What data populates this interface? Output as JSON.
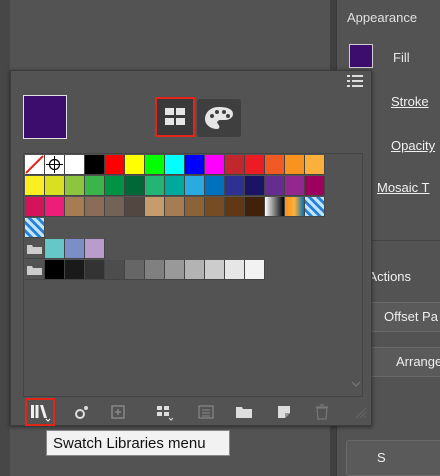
{
  "appearance": {
    "title": "Appearance",
    "fill_label": "Fill",
    "stroke_label": "Stroke",
    "opacity_label": "Opacity",
    "effect_label": "Mosaic T",
    "fill_color": "#3d0d6d"
  },
  "quick_actions": {
    "title": "k Actions",
    "offset_label": "Offset Pa",
    "arrange_label": "Arrange",
    "bottom_label": "S"
  },
  "swatches_panel": {
    "fill_color": "#3d0d6d",
    "rows": [
      [
        "none",
        "registration",
        "#ffffff",
        "#000000",
        "#ff0000",
        "#ffff00",
        "#00ff00",
        "#00ffff",
        "#0000ff",
        "#ff00ff",
        "#c1272d",
        "#ed1c24",
        "#f15a24",
        "#f7931e",
        "#fbb03b"
      ],
      [
        "#fcee21",
        "#d9e021",
        "#8cc63f",
        "#39b54a",
        "#009245",
        "#006837",
        "#22b573",
        "#00a99d",
        "#29abe2",
        "#0071bc",
        "#2e3192",
        "#1b1464",
        "#662d91",
        "#93278f",
        "#9e005d"
      ],
      [
        "#d4145a",
        "#ed1e79",
        "#a67c52",
        "#8b6d57",
        "#736357",
        "#534741",
        "#c69c6d",
        "#a67c52",
        "#8c6239",
        "#754c24",
        "#603813",
        "#42210b",
        "gradient-bw",
        "gradient-orange",
        "pattern-blue"
      ],
      [
        "pattern-blue2"
      ],
      [
        "folder",
        "#66c7c9",
        "#7b8ec8",
        "#b89ccc"
      ],
      [
        "folder",
        "#000000",
        "#1a1a1a",
        "#333333",
        "#4d4d4d",
        "#666666",
        "#808080",
        "#999999",
        "#b3b3b3",
        "#cccccc",
        "#e6e6e6",
        "#f2f2f2"
      ]
    ]
  },
  "tooltip": {
    "text": "Swatch Libraries menu"
  },
  "colors": {
    "highlight": "#e1251b"
  }
}
